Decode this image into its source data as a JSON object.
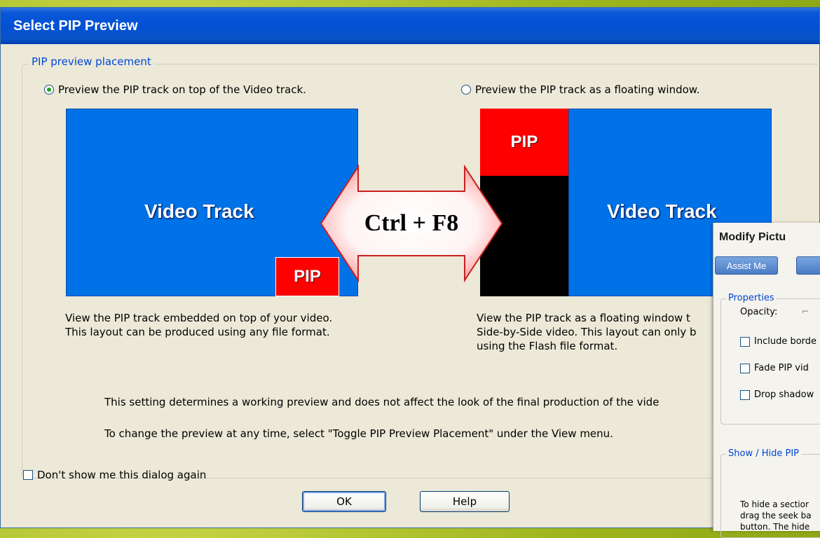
{
  "dialog": {
    "title": "Select PIP Preview",
    "group_label": "PIP preview placement",
    "option_top": {
      "label": "Preview the PIP track on top of the Video track.",
      "checked": true
    },
    "option_float": {
      "label": "Preview the PIP track as a floating window.",
      "checked": false
    },
    "left_preview": {
      "video_label": "Video Track",
      "pip_label": "PIP"
    },
    "right_preview": {
      "video_label": "Video Track",
      "pip_label": "PIP"
    },
    "shortcut_label": "Ctrl + F8",
    "left_desc": [
      "View the PIP track embedded on top of your video.",
      "This layout can be produced using any file format."
    ],
    "right_desc": [
      "View the PIP track as a floating window t",
      "Side-by-Side video. This layout can only b",
      "using the Flash file format."
    ],
    "note1": "This setting determines a working preview and does not affect the look of the final production of the vide",
    "note2": "To change the preview at any time, select \"Toggle PIP Preview Placement\" under the View menu.",
    "dont_show_label": "Don't show me this dialog again",
    "ok_label": "OK",
    "help_label": "Help"
  },
  "side_panel": {
    "title": "Modify Pictu",
    "assist_label": "Assist Me",
    "properties_label": "Properties",
    "opacity_label": "Opacity:",
    "include_border_label": "Include borde",
    "fade_label": "Fade PIP vid",
    "drop_shadow_label": "Drop shadow",
    "show_hide_label": "Show / Hide PIP",
    "show_hide_text": [
      "To hide a sectior",
      "drag the seek ba",
      "button. The hide"
    ]
  },
  "colors": {
    "video_blue": "#0072e8",
    "pip_red": "#ff0000",
    "title_blue": "#0a56d8",
    "dialog_bg": "#ece9d8"
  }
}
